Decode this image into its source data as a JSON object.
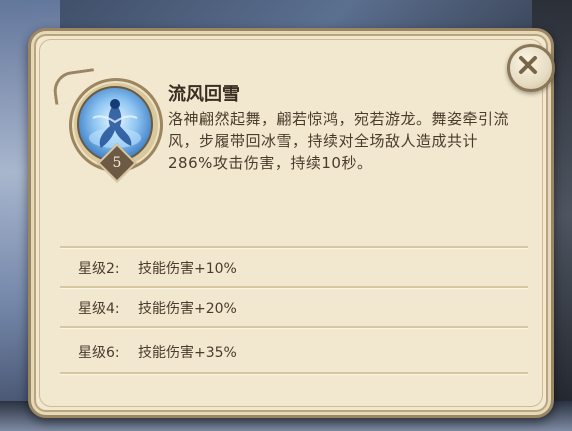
{
  "skill": {
    "name": "流风回雪",
    "description": "洛神翩然起舞，翩若惊鸿，宛若游龙。舞姿牵引流风，步履带回冰雪，持续对全场敌人造成共计286%攻击伤害，持续10秒。",
    "level": "5",
    "icon": "dancing-goddess-icon"
  },
  "stars": [
    {
      "label": "星级2:",
      "effect": "技能伤害+10%"
    },
    {
      "label": "星级4:",
      "effect": "技能伤害+20%"
    },
    {
      "label": "星级6:",
      "effect": "技能伤害+35%"
    }
  ],
  "colors": {
    "panel_bg": "#f2e8cf",
    "panel_border": "#9b8664",
    "text_dark": "#3a2e22",
    "icon_blue": "#3f7fc7"
  },
  "close_icon": "close-icon"
}
